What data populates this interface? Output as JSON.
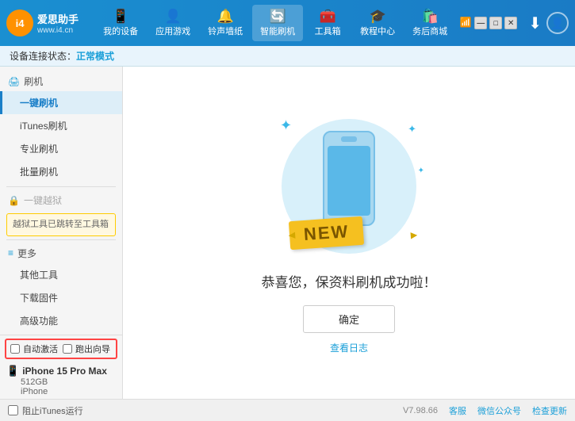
{
  "app": {
    "logo_text_line1": "爱思助手",
    "logo_text_line2": "www.i4.cn",
    "logo_abbr": "i4"
  },
  "nav": {
    "items": [
      {
        "id": "my-device",
        "label": "我的设备",
        "icon": "📱"
      },
      {
        "id": "apps-games",
        "label": "应用游戏",
        "icon": "👤"
      },
      {
        "id": "ringtone",
        "label": "铃声墙纸",
        "icon": "🔔"
      },
      {
        "id": "smart-flash",
        "label": "智能刷机",
        "icon": "🔄"
      },
      {
        "id": "toolbox",
        "label": "工具箱",
        "icon": "🧰"
      },
      {
        "id": "tutorial",
        "label": "教程中心",
        "icon": "🎓"
      },
      {
        "id": "service",
        "label": "务后商城",
        "icon": "🛍️"
      }
    ],
    "active": "smart-flash"
  },
  "header_right": {
    "download_icon": "⬇",
    "user_icon": "👤"
  },
  "status_bar": {
    "prefix": "设备连接状态：",
    "status": "正常模式"
  },
  "sidebar": {
    "sections": [
      {
        "id": "flash",
        "header_icon": "🖨",
        "header_label": "刷机",
        "items": [
          {
            "id": "one-click-flash",
            "label": "一键刷机",
            "active": true
          },
          {
            "id": "itunes-flash",
            "label": "iTunes刷机",
            "active": false
          },
          {
            "id": "pro-flash",
            "label": "专业刷机",
            "active": false
          },
          {
            "id": "batch-flash",
            "label": "批量刷机",
            "active": false
          }
        ]
      },
      {
        "id": "more",
        "header_icon": "≡",
        "header_label": "更多",
        "items": [
          {
            "id": "other-tools",
            "label": "其他工具",
            "active": false
          },
          {
            "id": "download-firmware",
            "label": "下载固件",
            "active": false
          },
          {
            "id": "advanced",
            "label": "高级功能",
            "active": false
          }
        ]
      }
    ],
    "disabled_item": {
      "icon": "🔒",
      "label": "一键越狱"
    },
    "note_text": "越狱工具已跳转至工具箱"
  },
  "content": {
    "new_badge": "NEW",
    "success_text": "恭喜您，保资料刷机成功啦！",
    "confirm_button": "确定",
    "log_link": "查看日志"
  },
  "device_section": {
    "auto_activate_label": "自动激活",
    "guide_label": "跑出向导",
    "device_icon": "📱",
    "device_name": "iPhone 15 Pro Max",
    "device_storage": "512GB",
    "device_type": "iPhone"
  },
  "footer": {
    "stop_itunes_icon": "☑",
    "stop_itunes_label": "阻止iTunes运行",
    "version": "V7.98.66",
    "official": "客服",
    "wechat": "微信公众号",
    "check_update": "检查更新"
  }
}
